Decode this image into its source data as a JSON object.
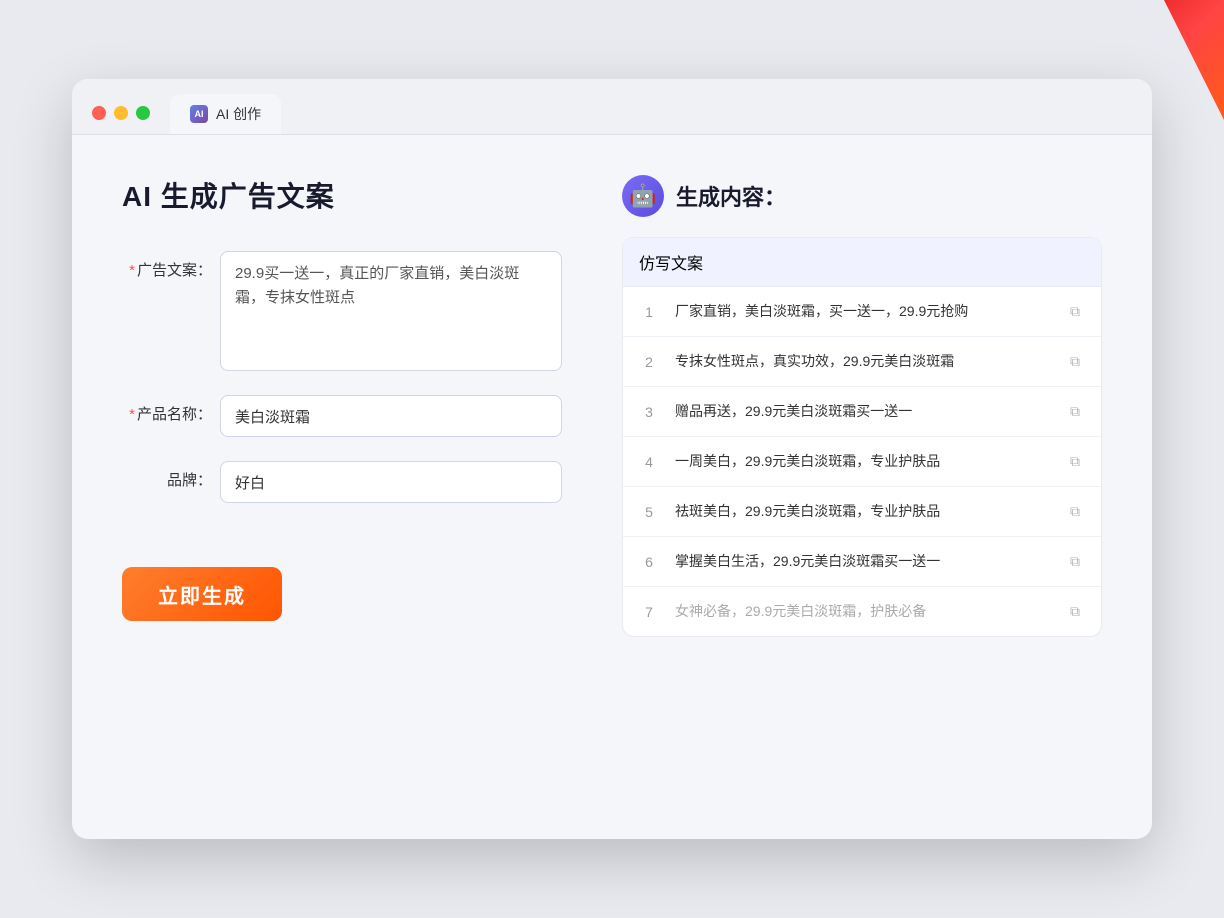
{
  "decorations": {
    "corner": "top-right red decoration"
  },
  "browser": {
    "tab_icon_label": "AI",
    "tab_label": "AI 创作"
  },
  "left_panel": {
    "page_title": "AI 生成广告文案",
    "form": {
      "ad_copy_label": "广告文案：",
      "ad_copy_required": "*",
      "ad_copy_value": "29.9买一送一，真正的厂家直销，美白淡斑霜，专抹女性斑点",
      "product_name_label": "产品名称：",
      "product_name_required": "*",
      "product_name_value": "美白淡斑霜",
      "brand_label": "品牌：",
      "brand_value": "好白"
    },
    "generate_button": "立即生成"
  },
  "right_panel": {
    "title": "生成内容：",
    "table_header": "仿写文案",
    "results": [
      {
        "num": "1",
        "text": "厂家直销，美白淡斑霜，买一送一，29.9元抢购",
        "muted": false
      },
      {
        "num": "2",
        "text": "专抹女性斑点，真实功效，29.9元美白淡斑霜",
        "muted": false
      },
      {
        "num": "3",
        "text": "赠品再送，29.9元美白淡斑霜买一送一",
        "muted": false
      },
      {
        "num": "4",
        "text": "一周美白，29.9元美白淡斑霜，专业护肤品",
        "muted": false
      },
      {
        "num": "5",
        "text": "祛斑美白，29.9元美白淡斑霜，专业护肤品",
        "muted": false
      },
      {
        "num": "6",
        "text": "掌握美白生活，29.9元美白淡斑霜买一送一",
        "muted": false
      },
      {
        "num": "7",
        "text": "女神必备，29.9元美白淡斑霜，护肤必备",
        "muted": true
      }
    ],
    "copy_icon": "⧉"
  }
}
